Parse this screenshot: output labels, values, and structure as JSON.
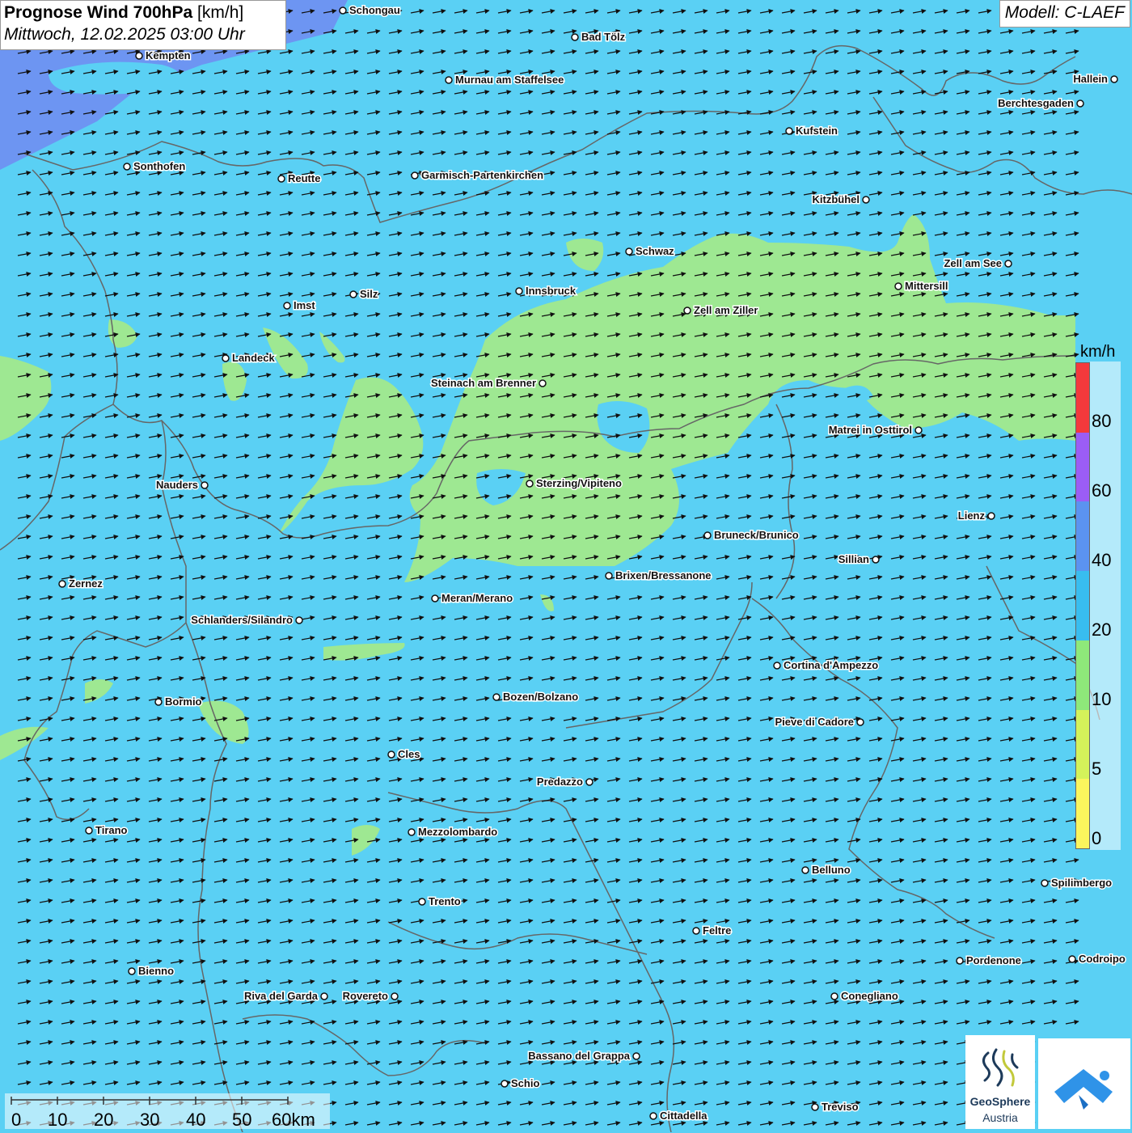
{
  "header": {
    "title_bold": "Prognose Wind 700hPa",
    "title_unit": "[km/h]",
    "datetime": "Mittwoch, 12.02.2025 03:00 Uhr",
    "model": "Modell: C-LAEF"
  },
  "legend": {
    "unit": "km/h",
    "labels": [
      "80",
      "60",
      "40",
      "20",
      "10",
      "5",
      "0"
    ],
    "colors": [
      "#f4393c",
      "#9b5df5",
      "#5b93f0",
      "#38bdef",
      "#8ee87a",
      "#d4f25a",
      "#fbf55d"
    ]
  },
  "scale": {
    "labels": [
      "0",
      "10",
      "20",
      "30",
      "40",
      "50",
      "60km"
    ]
  },
  "logo": {
    "name": "GeoSphere",
    "country": "Austria",
    "icon": "geosphere-logo-icon"
  },
  "app_icon": "wetter-app-icon",
  "colors": {
    "base_wind": "#5ad0f4",
    "low_wind": "#9ee892",
    "strong_wind": "#6f8ef2",
    "borders": "#666666"
  },
  "cities": [
    {
      "name": "Schongau"
    },
    {
      "name": "Kempten"
    },
    {
      "name": "Bad Tölz"
    },
    {
      "name": "Murnau am Staffelsee"
    },
    {
      "name": "Hallein"
    },
    {
      "name": "Berchtesgaden"
    },
    {
      "name": "Kufstein"
    },
    {
      "name": "Sonthofen"
    },
    {
      "name": "Reutte"
    },
    {
      "name": "Garmisch-Partenkirchen"
    },
    {
      "name": "Kitzbühel"
    },
    {
      "name": "Schwaz"
    },
    {
      "name": "Zell am See"
    },
    {
      "name": "Mittersill"
    },
    {
      "name": "Innsbruck"
    },
    {
      "name": "Silz"
    },
    {
      "name": "Imst"
    },
    {
      "name": "Zell am Ziller"
    },
    {
      "name": "Landeck"
    },
    {
      "name": "Steinach am Brenner"
    },
    {
      "name": "Matrei in Osttirol"
    },
    {
      "name": "Nauders"
    },
    {
      "name": "Sterzing/Vipiteno"
    },
    {
      "name": "Lienz"
    },
    {
      "name": "Bruneck/Brunico"
    },
    {
      "name": "Sillian"
    },
    {
      "name": "Brixen/Bressanone"
    },
    {
      "name": "Zernez"
    },
    {
      "name": "Meran/Merano"
    },
    {
      "name": "Schlanders/Silandro"
    },
    {
      "name": "Cortina d'Ampezzo"
    },
    {
      "name": "Bozen/Bolzano"
    },
    {
      "name": "Bormio"
    },
    {
      "name": "Pieve di Cadore"
    },
    {
      "name": "Cles"
    },
    {
      "name": "Predazzo"
    },
    {
      "name": "Tirano"
    },
    {
      "name": "Mezzolombardo"
    },
    {
      "name": "Belluno"
    },
    {
      "name": "Spilimbergo"
    },
    {
      "name": "Trento"
    },
    {
      "name": "Feltre"
    },
    {
      "name": "Bienno"
    },
    {
      "name": "Pordenone"
    },
    {
      "name": "Codroipo"
    },
    {
      "name": "Riva del Garda"
    },
    {
      "name": "Rovereto"
    },
    {
      "name": "Conegliano"
    },
    {
      "name": "Bassano del Grappa"
    },
    {
      "name": "Schio"
    },
    {
      "name": "Treviso"
    },
    {
      "name": "Cittadella"
    }
  ]
}
